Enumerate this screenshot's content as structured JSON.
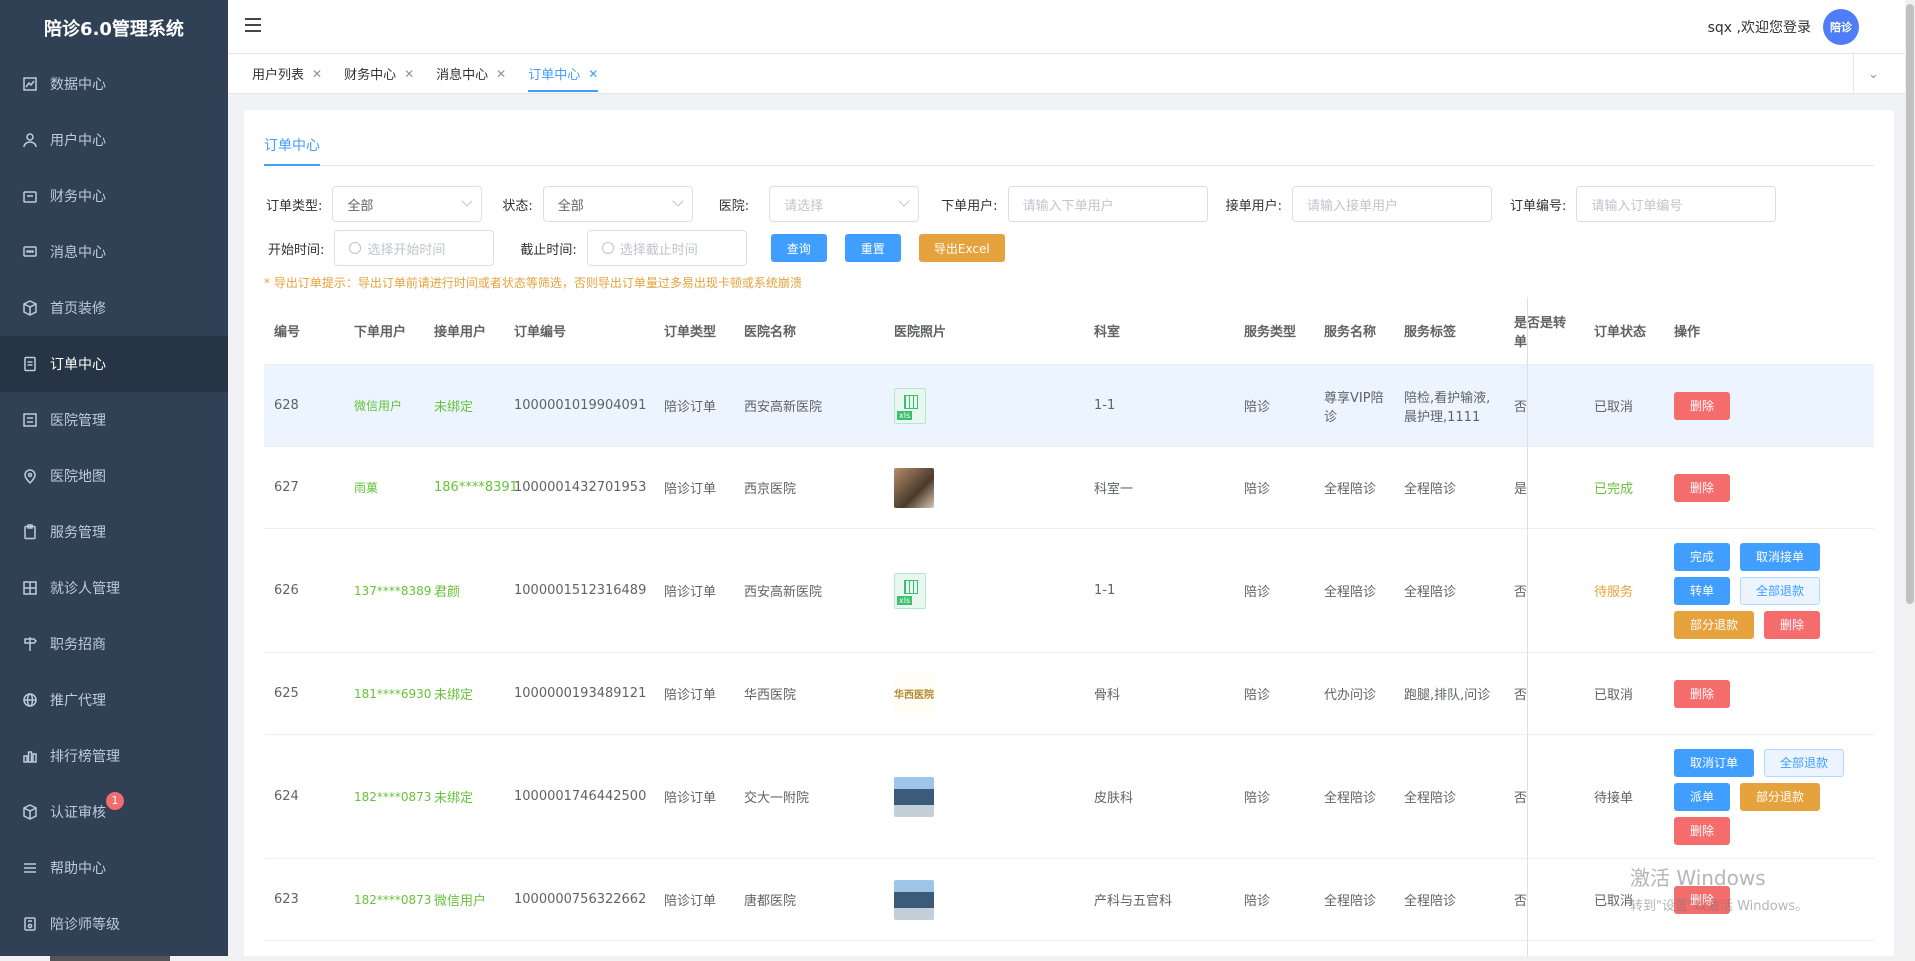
{
  "app": {
    "title": "陪诊6.0管理系统"
  },
  "sidebar": {
    "items": [
      {
        "label": "数据中心",
        "icon": "chart-icon"
      },
      {
        "label": "用户中心",
        "icon": "user-icon"
      },
      {
        "label": "财务中心",
        "icon": "wallet-icon"
      },
      {
        "label": "消息中心",
        "icon": "message-icon"
      },
      {
        "label": "首页装修",
        "icon": "cube-icon"
      },
      {
        "label": "订单中心",
        "icon": "document-icon"
      },
      {
        "label": "医院管理",
        "icon": "list-icon"
      },
      {
        "label": "医院地图",
        "icon": "location-icon"
      },
      {
        "label": "服务管理",
        "icon": "clipboard-icon"
      },
      {
        "label": "就诊人管理",
        "icon": "grid-icon"
      },
      {
        "label": "职务招商",
        "icon": "signpost-icon"
      },
      {
        "label": "推广代理",
        "icon": "globe-icon"
      },
      {
        "label": "排行榜管理",
        "icon": "bar-chart-icon"
      },
      {
        "label": "认证审核",
        "icon": "cube-icon",
        "badge": "1"
      },
      {
        "label": "帮助中心",
        "icon": "menu-list-icon"
      },
      {
        "label": "陪诊师等级",
        "icon": "level-icon"
      }
    ]
  },
  "header": {
    "welcome": "sqx ,欢迎您登录",
    "avatar_text": "陪诊"
  },
  "tabs": [
    {
      "label": "用户列表"
    },
    {
      "label": "财务中心"
    },
    {
      "label": "消息中心"
    },
    {
      "label": "订单中心"
    }
  ],
  "page": {
    "tab_label": "订单中心"
  },
  "filters": {
    "order_type_label": "订单类型:",
    "order_type_value": "全部",
    "status_label": "状态:",
    "status_value": "全部",
    "hospital_label": "医院:",
    "hospital_placeholder": "请选择",
    "order_user_label": "下单用户:",
    "order_user_placeholder": "请输入下单用户",
    "accept_user_label": "接单用户:",
    "accept_user_placeholder": "请输入接单用户",
    "order_no_label": "订单编号:",
    "order_no_placeholder": "请输入订单编号",
    "start_label": "开始时间:",
    "start_placeholder": "选择开始时间",
    "end_label": "截止时间:",
    "end_placeholder": "选择截止时间",
    "query_btn": "查询",
    "reset_btn": "重置",
    "export_btn": "导出Excel",
    "tip": "* 导出订单提示：导出订单前请进行时间或者状态等筛选，否则导出订单量过多易出现卡顿或系统崩溃"
  },
  "table": {
    "headers": {
      "no": "编号",
      "order_user": "下单用户",
      "accept_user": "接单用户",
      "order_no": "订单编号",
      "order_type": "订单类型",
      "hospital": "医院名称",
      "photo": "医院照片",
      "dept": "科室",
      "service_type": "服务类型",
      "service_name": "服务名称",
      "service_tag": "服务标签",
      "transfer": "是否是转单",
      "status": "订单状态",
      "ops": "操作"
    },
    "rows": [
      {
        "no": "628",
        "order_user": "微信用户",
        "accept_user": "未绑定",
        "order_no": "1000001019904091",
        "order_type": "陪诊订单",
        "hospital": "西安高新医院",
        "photo": "xls",
        "dept": "1-1",
        "service_type": "陪诊",
        "service_name": "尊享VIP陪诊",
        "service_tag": "陪检,看护输液,晨护理,1111",
        "transfer": "否",
        "status": "已取消"
      },
      {
        "no": "627",
        "order_user": "雨菓",
        "accept_user": "186****8391",
        "order_no": "1000001432701953",
        "order_type": "陪诊订单",
        "hospital": "西京医院",
        "photo": "brown",
        "dept": "科室一",
        "service_type": "陪诊",
        "service_name": "全程陪诊",
        "service_tag": "全程陪诊",
        "transfer": "是",
        "status": "已完成"
      },
      {
        "no": "626",
        "order_user": "137****8389",
        "accept_user": "君颜",
        "order_no": "1000001512316489",
        "order_type": "陪诊订单",
        "hospital": "西安高新医院",
        "photo": "xls",
        "dept": "1-1",
        "service_type": "陪诊",
        "service_name": "全程陪诊",
        "service_tag": "全程陪诊",
        "transfer": "否",
        "status": "待服务"
      },
      {
        "no": "625",
        "order_user": "181****6930",
        "accept_user": "未绑定",
        "order_no": "1000000193489121",
        "order_type": "陪诊订单",
        "hospital": "华西医院",
        "photo": "logo",
        "dept": "骨科",
        "service_type": "陪诊",
        "service_name": "代办问诊",
        "service_tag": "跑腿,排队,问诊",
        "transfer": "否",
        "status": "已取消"
      },
      {
        "no": "624",
        "order_user": "182****0873",
        "accept_user": "未绑定",
        "order_no": "1000001746442500",
        "order_type": "陪诊订单",
        "hospital": "交大一附院",
        "photo": "building",
        "dept": "皮肤科",
        "service_type": "陪诊",
        "service_name": "全程陪诊",
        "service_tag": "全程陪诊",
        "transfer": "否",
        "status": "待接单"
      },
      {
        "no": "623",
        "order_user": "182****0873",
        "accept_user": "微信用户",
        "order_no": "1000000756322662",
        "order_type": "陪诊订单",
        "hospital": "唐都医院",
        "photo": "building",
        "dept": "产科与五官科",
        "service_type": "陪诊",
        "service_name": "全程陪诊",
        "service_tag": "全程陪诊",
        "transfer": "否",
        "status": "已取消"
      }
    ],
    "ops_labels": {
      "delete": "删除",
      "complete": "完成",
      "cancel_accept": "取消接单",
      "transfer": "转单",
      "full_refund": "全部退款",
      "partial_refund": "部分退款",
      "cancel_order": "取消订单",
      "dispatch": "派单"
    },
    "logo_text": "华西医院"
  },
  "watermark": {
    "line1": "激活 Windows",
    "line2": "转到\"设置\"以激活 Windows。"
  },
  "colors": {
    "sidebar_bg": "#304156",
    "primary": "#409eff",
    "danger": "#f56c6c",
    "warning": "#e6a23c",
    "success": "#67c23a"
  }
}
